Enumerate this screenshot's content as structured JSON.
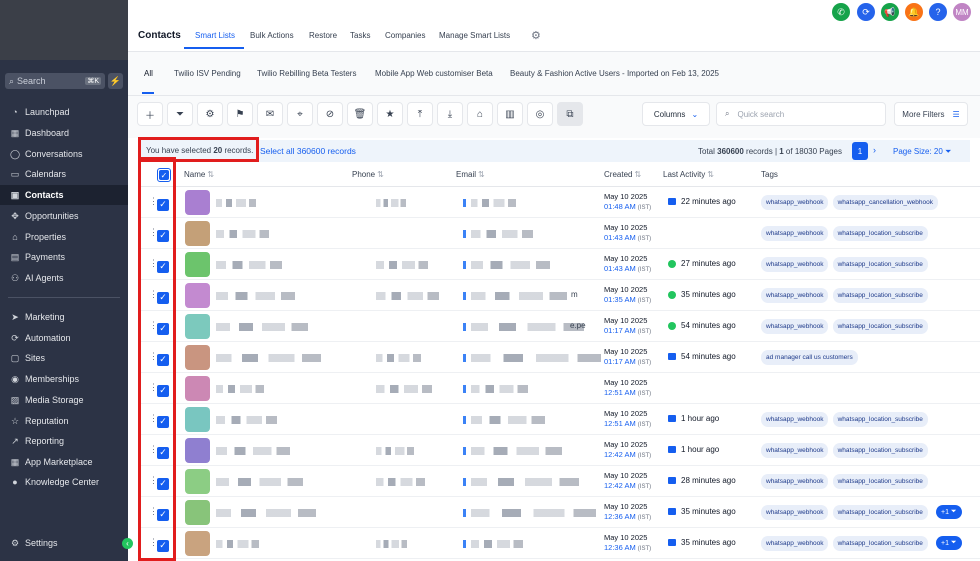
{
  "sidebar": {
    "search_placeholder": "Search",
    "search_shortcut": "⌘K",
    "items": [
      {
        "label": "Launchpad",
        "icon": "launchpad-icon"
      },
      {
        "label": "Dashboard",
        "icon": "dashboard-icon"
      },
      {
        "label": "Conversations",
        "icon": "chat-icon"
      },
      {
        "label": "Calendars",
        "icon": "calendar-icon"
      },
      {
        "label": "Contacts",
        "icon": "contacts-icon"
      },
      {
        "label": "Opportunities",
        "icon": "opportunities-icon"
      },
      {
        "label": "Properties",
        "icon": "properties-icon"
      },
      {
        "label": "Payments",
        "icon": "payments-icon"
      },
      {
        "label": "AI Agents",
        "icon": "ai-agents-icon"
      },
      {
        "label": "Marketing",
        "icon": "send-icon"
      },
      {
        "label": "Automation",
        "icon": "automation-icon"
      },
      {
        "label": "Sites",
        "icon": "sites-icon"
      },
      {
        "label": "Memberships",
        "icon": "memberships-icon"
      },
      {
        "label": "Media Storage",
        "icon": "media-icon"
      },
      {
        "label": "Reputation",
        "icon": "star-icon"
      },
      {
        "label": "Reporting",
        "icon": "reporting-icon"
      },
      {
        "label": "App Marketplace",
        "icon": "marketplace-icon"
      },
      {
        "label": "Knowledge Center",
        "icon": "info-icon"
      },
      {
        "label": "Settings",
        "icon": "gear-icon"
      }
    ]
  },
  "header": {
    "title": "Contacts",
    "tabs": [
      "Smart Lists",
      "Bulk Actions",
      "Restore",
      "Tasks",
      "Companies",
      "Manage Smart Lists"
    ],
    "avatar_initials": "MM",
    "colors": {
      "phone": "#16a34a",
      "sync": "#2563eb",
      "megaphone": "#16a34a",
      "bell": "#f97316",
      "help": "#2563eb",
      "avatar": "#c084c4"
    }
  },
  "smart_lists": [
    "All",
    "Twilio ISV Pending",
    "Twilio Rebilling Beta Testers",
    "Mobile App Web customiser Beta",
    "Beauty & Fashion Active Users - Imported on Feb 13, 2025"
  ],
  "toolbar": {
    "columns_label": "Columns",
    "search_placeholder": "Quick search",
    "more_filters_label": "More Filters"
  },
  "selection": {
    "prefix": "You have selected ",
    "count": "20",
    "suffix": " records.",
    "select_all": "Select all 360600 records",
    "total_label": "Total ",
    "total_count": "360600",
    "records_word": " records | ",
    "page_current": "1",
    "page_of": " of 18030 Pages",
    "page_button": "1",
    "page_size": "Page Size: 20"
  },
  "table": {
    "columns": [
      "Name",
      "Phone",
      "Email",
      "Created",
      "Last Activity",
      "Tags"
    ],
    "rows": [
      {
        "date": "May 10 2025",
        "time": "01:48 AM",
        "tz": "(IST)",
        "activity": "22 minutes ago",
        "act": "email",
        "tags": [
          "whatsapp_webhook",
          "whatsapp_cancellation_webhook"
        ],
        "extra": "",
        "avatar": "#a97fd1",
        "snip": ""
      },
      {
        "date": "May 10 2025",
        "time": "01:43 AM",
        "tz": "(IST)",
        "activity": "",
        "act": "",
        "tags": [
          "whatsapp_webhook",
          "whatsapp_location_subscribe"
        ],
        "extra": "",
        "avatar": "#c4a078",
        "snip": ""
      },
      {
        "date": "May 10 2025",
        "time": "01:43 AM",
        "tz": "(IST)",
        "activity": "27 minutes ago",
        "act": "whatsapp",
        "tags": [
          "whatsapp_webhook",
          "whatsapp_location_subscribe"
        ],
        "extra": "",
        "avatar": "#6cc46c",
        "snip": ""
      },
      {
        "date": "May 10 2025",
        "time": "01:35 AM",
        "tz": "(IST)",
        "activity": "35 minutes ago",
        "act": "whatsapp",
        "tags": [
          "whatsapp_webhook",
          "whatsapp_location_subscribe"
        ],
        "extra": "",
        "avatar": "#c38ad0",
        "snip": "m"
      },
      {
        "date": "May 10 2025",
        "time": "01:17 AM",
        "tz": "(IST)",
        "activity": "54 minutes ago",
        "act": "whatsapp",
        "tags": [
          "whatsapp_webhook",
          "whatsapp_location_subscribe"
        ],
        "extra": "",
        "avatar": "#7cc9bd",
        "snip": "e.pe"
      },
      {
        "date": "May 10 2025",
        "time": "01:17 AM",
        "tz": "(IST)",
        "activity": "54 minutes ago",
        "act": "email",
        "tags": [
          "ad manager call us customers"
        ],
        "extra": "",
        "avatar": "#c99580",
        "snip": ""
      },
      {
        "date": "May 10 2025",
        "time": "12:51 AM",
        "tz": "(IST)",
        "activity": "",
        "act": "",
        "tags": [],
        "extra": "",
        "avatar": "#cc88b4",
        "snip": ""
      },
      {
        "date": "May 10 2025",
        "time": "12:51 AM",
        "tz": "(IST)",
        "activity": "1 hour ago",
        "act": "email",
        "tags": [
          "whatsapp_webhook",
          "whatsapp_location_subscribe"
        ],
        "extra": "",
        "avatar": "#79c6c0",
        "snip": ""
      },
      {
        "date": "May 10 2025",
        "time": "12:42 AM",
        "tz": "(IST)",
        "activity": "1 hour ago",
        "act": "email",
        "tags": [
          "whatsapp_webhook",
          "whatsapp_location_subscribe"
        ],
        "extra": "",
        "avatar": "#8f7fd0",
        "snip": ""
      },
      {
        "date": "May 10 2025",
        "time": "12:42 AM",
        "tz": "(IST)",
        "activity": "28 minutes ago",
        "act": "email",
        "tags": [
          "whatsapp_webhook",
          "whatsapp_location_subscribe"
        ],
        "extra": "",
        "avatar": "#8ccd84",
        "snip": ""
      },
      {
        "date": "May 10 2025",
        "time": "12:36 AM",
        "tz": "(IST)",
        "activity": "35 minutes ago",
        "act": "email",
        "tags": [
          "whatsapp_webhook",
          "whatsapp_location_subscribe"
        ],
        "extra": "+1",
        "avatar": "#88c47a",
        "snip": ""
      },
      {
        "date": "May 10 2025",
        "time": "12:36 AM",
        "tz": "(IST)",
        "activity": "35 minutes ago",
        "act": "email",
        "tags": [
          "whatsapp_webhook",
          "whatsapp_location_subscribe"
        ],
        "extra": "+1",
        "avatar": "#c9a37f",
        "snip": ""
      }
    ]
  }
}
